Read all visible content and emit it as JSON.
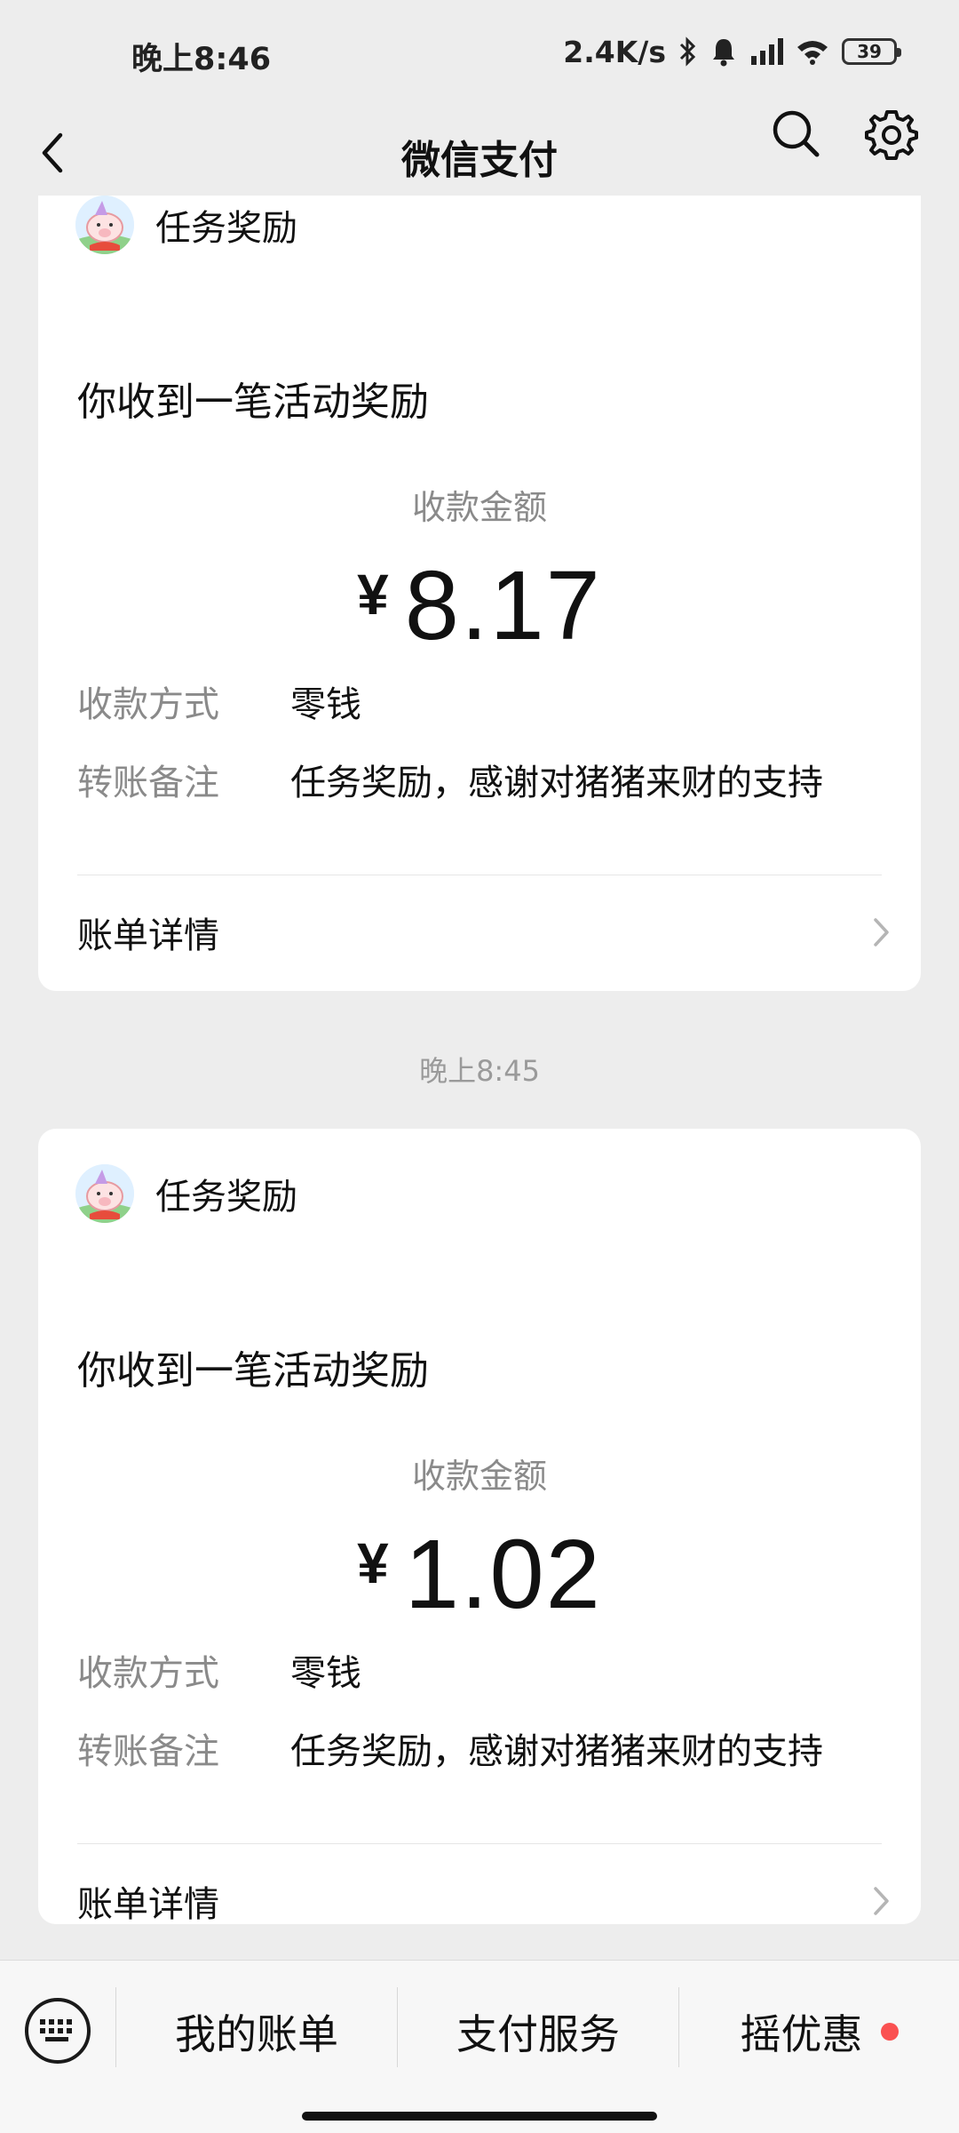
{
  "status_bar": {
    "time": "晚上8:46",
    "net_speed": "2.4K/s",
    "battery": "39"
  },
  "nav": {
    "title": "微信支付"
  },
  "cards": [
    {
      "sender": "任务奖励",
      "headline": "你收到一笔活动奖励",
      "amount_label": "收款金额",
      "currency": "¥",
      "amount": "8.17",
      "method_label": "收款方式",
      "method_value": "零钱",
      "note_label": "转账备注",
      "note_value": "任务奖励，感谢对猪猪来财的支持",
      "bill_label": "账单详情"
    },
    {
      "sender": "任务奖励",
      "headline": "你收到一笔活动奖励",
      "amount_label": "收款金额",
      "currency": "¥",
      "amount": "1.02",
      "method_label": "收款方式",
      "method_value": "零钱",
      "note_label": "转账备注",
      "note_value": "任务奖励，感谢对猪猪来财的支持",
      "bill_label": "账单详情"
    }
  ],
  "time_separator": "晚上8:45",
  "toolbar": {
    "items": [
      "我的账单",
      "支付服务",
      "摇优惠"
    ]
  },
  "icons": {
    "back": "back-arrow-icon",
    "search": "search-icon",
    "settings": "gear-icon",
    "keyboard": "keyboard-icon",
    "chevron": "chevron-right-icon",
    "bluetooth": "bluetooth-icon",
    "bell": "bell-icon",
    "signal": "signal-icon",
    "wifi": "wifi-icon"
  },
  "colors": {
    "background": "#ededed",
    "card": "#ffffff",
    "badge_red": "#fa5151",
    "muted_text": "#8a8a8a"
  }
}
